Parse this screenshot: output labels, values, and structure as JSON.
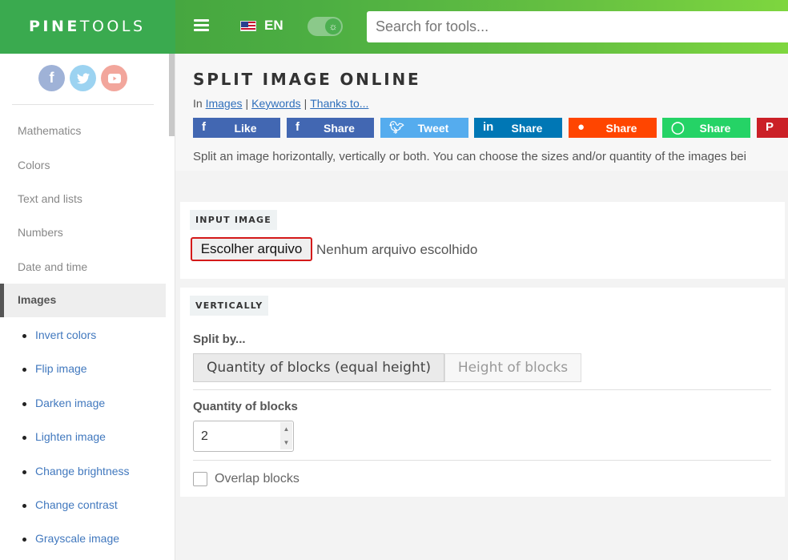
{
  "header": {
    "logo_bold": "PINE",
    "logo_light": "TOOLS",
    "lang": "EN",
    "search_placeholder": "Search for tools..."
  },
  "sidebar": {
    "categories": [
      "Mathematics",
      "Colors",
      "Text and lists",
      "Numbers",
      "Date and time"
    ],
    "active_category": "Images",
    "sub_items": [
      "Invert colors",
      "Flip image",
      "Darken image",
      "Lighten image",
      "Change brightness",
      "Change contrast",
      "Grayscale image"
    ]
  },
  "main": {
    "title": "SPLIT IMAGE ONLINE",
    "breadcrumb": {
      "prefix": "In",
      "links": [
        "Images",
        "Keywords",
        "Thanks to..."
      ]
    },
    "share_buttons": [
      {
        "label": "Like",
        "icon": "f",
        "color": "#4267b2"
      },
      {
        "label": "Share",
        "icon": "f",
        "color": "#4267b2"
      },
      {
        "label": "Tweet",
        "icon": "t",
        "color": "#55acee"
      },
      {
        "label": "Share",
        "icon": "in",
        "color": "#0077b5"
      },
      {
        "label": "Share",
        "icon": "r",
        "color": "#ff4500"
      },
      {
        "label": "Share",
        "icon": "w",
        "color": "#25d366"
      },
      {
        "label": "P",
        "icon": "p",
        "color": "#cb2027"
      }
    ],
    "description": "Split an image horizontally, vertically or both. You can choose the sizes and/or quantity of the images bei",
    "input_panel": {
      "label": "INPUT IMAGE",
      "file_button": "Escolher arquivo",
      "file_status": "Nenhum arquivo escolhido"
    },
    "vertical_panel": {
      "label": "VERTICALLY",
      "split_by_label": "Split by...",
      "options": [
        "Quantity of blocks (equal height)",
        "Height of blocks"
      ],
      "quantity_label": "Quantity of blocks",
      "quantity_value": "2",
      "overlap_label": "Overlap blocks"
    }
  }
}
